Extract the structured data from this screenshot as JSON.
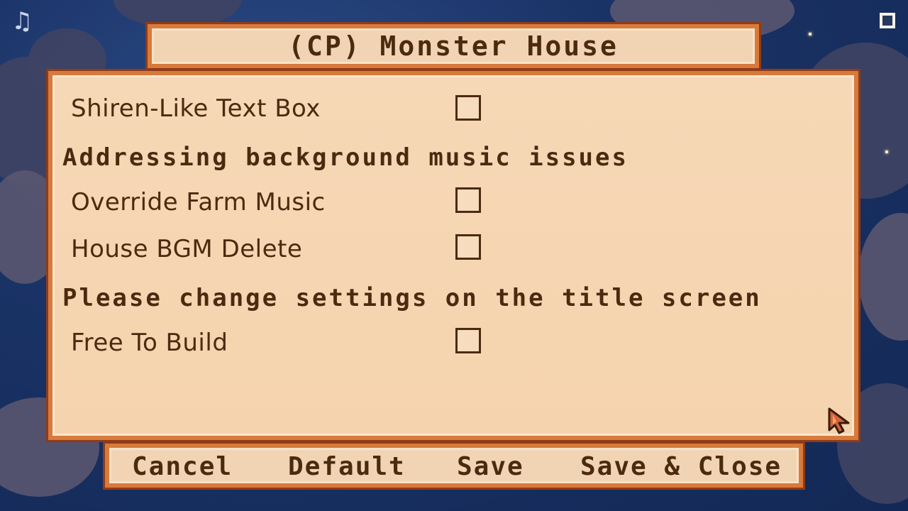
{
  "window": {
    "title": "(CP) Monster House"
  },
  "icons": {
    "music": "music-note-icon",
    "fullscreen": "fullscreen-toggle-icon",
    "cursor": "mouse-pointer-icon"
  },
  "settings": {
    "option_shiren": {
      "label": "Shiren-Like Text Box",
      "checked": false
    },
    "section_music": "Addressing background music issues",
    "option_farm_music": {
      "label": "Override Farm Music",
      "checked": false
    },
    "option_house_bgm": {
      "label": "House BGM Delete",
      "checked": false
    },
    "section_title_screen": "Please change settings on the title screen",
    "option_free_build": {
      "label": "Free To Build",
      "checked": false
    }
  },
  "buttons": {
    "cancel": "Cancel",
    "default": "Default",
    "save": "Save",
    "save_close": "Save & Close"
  },
  "colors": {
    "panel": "#f5d3ae",
    "border": "#d77a3c",
    "text": "#4c2a10",
    "sky": "#1a3366"
  }
}
